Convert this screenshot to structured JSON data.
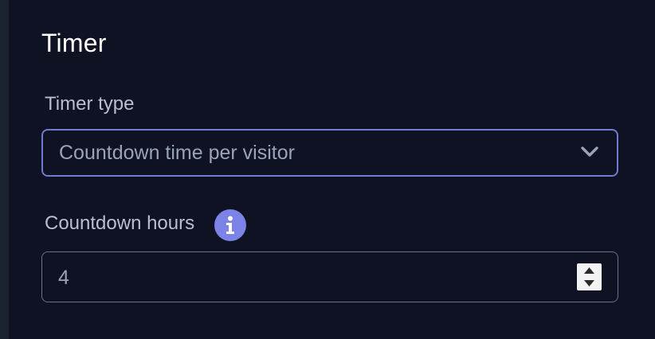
{
  "section": {
    "title": "Timer"
  },
  "timer_type": {
    "label": "Timer type",
    "selected": "Countdown time per visitor"
  },
  "countdown_hours": {
    "label": "Countdown hours",
    "value": "4"
  },
  "icons": {
    "select_chevron": "chevron-down-icon",
    "info": "info-icon",
    "stepper_up": "caret-up-icon",
    "stepper_down": "caret-down-icon"
  },
  "colors": {
    "background": "#0e1222",
    "accent": "#6f79d8",
    "info_icon": "#7b83e6"
  }
}
